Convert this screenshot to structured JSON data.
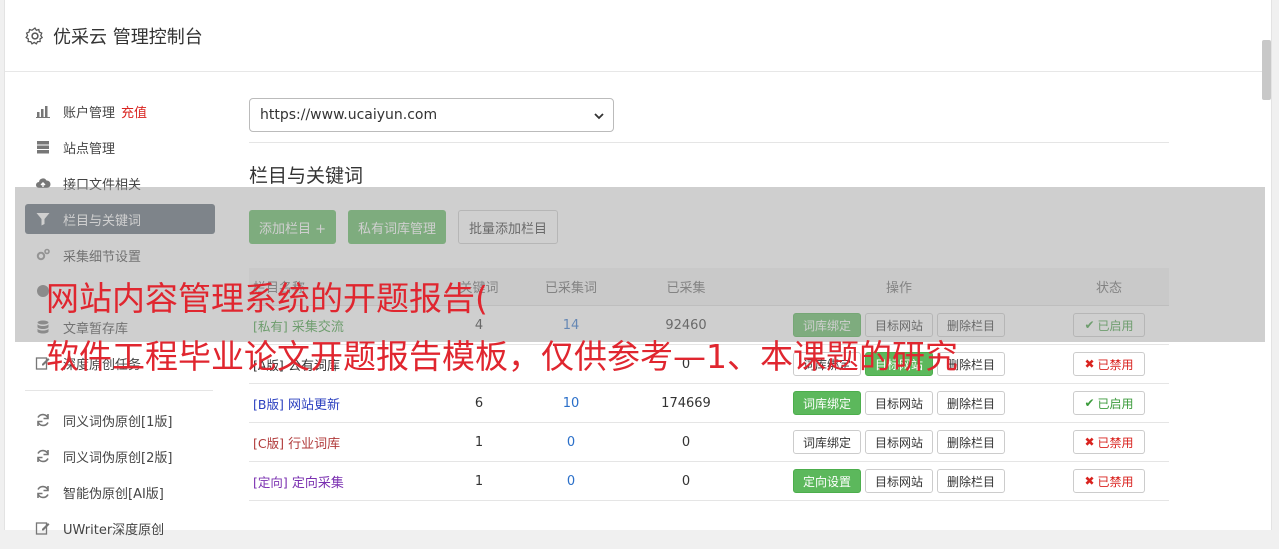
{
  "header": {
    "title": "优采云 管理控制台"
  },
  "sidebar": {
    "items": [
      {
        "label": "账户管理",
        "promo": "充值",
        "icon": "bar-chart-icon"
      },
      {
        "label": "站点管理",
        "icon": "server-icon"
      },
      {
        "label": "接口文件相关",
        "icon": "cloud-upload-icon"
      },
      {
        "label": "栏目与关键词",
        "icon": "filter-icon",
        "active": true
      },
      {
        "label": "采集细节设置",
        "icon": "cogs-icon"
      },
      {
        "label": "",
        "icon": "circle-icon"
      },
      {
        "label": "文章暂存库",
        "icon": "database-icon"
      },
      {
        "label": "深度原创任务",
        "icon": "edit-icon"
      }
    ],
    "tools": [
      {
        "label": "同义词伪原创[1版]",
        "icon": "refresh-icon"
      },
      {
        "label": "同义词伪原创[2版]",
        "icon": "refresh-icon"
      },
      {
        "label": "智能伪原创[AI版]",
        "icon": "refresh-icon"
      },
      {
        "label": "UWriter深度原创",
        "icon": "edit-icon"
      }
    ]
  },
  "main": {
    "site_select": "https://www.ucaiyun.com",
    "section_title": "栏目与关键词",
    "buttons": {
      "add_column": "添加栏目 +",
      "private_lexicon": "私有词库管理",
      "batch_add": "批量添加栏目"
    },
    "table": {
      "headers": {
        "name": "栏目名称",
        "col2": "关键词",
        "col3": "已采集词",
        "col4": "已采集",
        "ops": "操作",
        "status": "状态"
      },
      "rows": [
        {
          "tag": "[私有]",
          "name": "采集交流",
          "n1": "4",
          "n2": "14",
          "n3": "92460",
          "op1": "词库绑定",
          "op1_green": true,
          "op2": "目标网站",
          "op2_green": false,
          "op3": "删除栏目",
          "status": "已启用",
          "on": true,
          "color": "#3c9b3c"
        },
        {
          "tag": "[A版]",
          "name": "公有词库",
          "n1": "",
          "n2": "",
          "n3": "0",
          "op1": "词库绑定",
          "op1_green": false,
          "op2": "目标网站",
          "op2_green": true,
          "op3": "删除栏目",
          "status": "已禁用",
          "on": false,
          "color": "#333333"
        },
        {
          "tag": "[B版]",
          "name": "网站更新",
          "n1": "6",
          "n2": "10",
          "n3": "174669",
          "op1": "词库绑定",
          "op1_green": true,
          "op2": "目标网站",
          "op2_green": false,
          "op3": "删除栏目",
          "status": "已启用",
          "on": true,
          "color": "#2a3fbf"
        },
        {
          "tag": "[C版]",
          "name": "行业词库",
          "n1": "1",
          "n2": "0",
          "n3": "0",
          "op1": "词库绑定",
          "op1_green": false,
          "op2": "目标网站",
          "op2_green": false,
          "op3": "删除栏目",
          "status": "已禁用",
          "on": false,
          "color": "#b03a3a"
        },
        {
          "tag": "[定向]",
          "name": "定向采集",
          "n1": "1",
          "n2": "0",
          "n3": "0",
          "op1": "定向设置",
          "op1_green": true,
          "op2": "目标网站",
          "op2_green": false,
          "op3": "删除栏目",
          "status": "已禁用",
          "on": false,
          "color": "#7a2fb0"
        }
      ]
    }
  },
  "watermark": {
    "line1": "网站内容管理系统的开题报告(",
    "line2": "软件工程毕业论文开题报告模板，仅供参考—1、本课题的研究"
  }
}
